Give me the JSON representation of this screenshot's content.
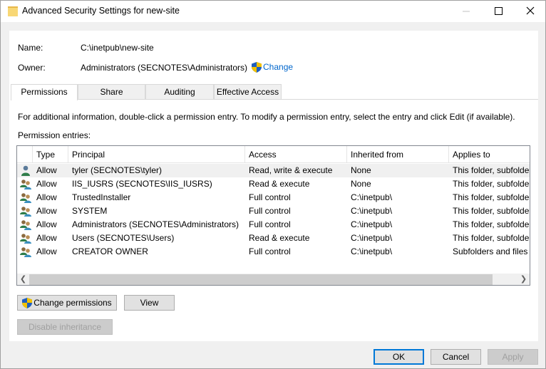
{
  "window": {
    "title": "Advanced Security Settings for new-site"
  },
  "info": {
    "name_label": "Name:",
    "name_value": "C:\\inetpub\\new-site",
    "owner_label": "Owner:",
    "owner_value": "Administrators (SECNOTES\\Administrators)",
    "change_link": "Change"
  },
  "tabs": [
    {
      "label": "Permissions",
      "active": true
    },
    {
      "label": "Share",
      "active": false
    },
    {
      "label": "Auditing",
      "active": false
    },
    {
      "label": "Effective Access",
      "active": false
    }
  ],
  "instructions": "For additional information, double-click a permission entry. To modify a permission entry, select the entry and click Edit (if available).",
  "entries_label": "Permission entries:",
  "columns": [
    "Type",
    "Principal",
    "Access",
    "Inherited from",
    "Applies to"
  ],
  "entries": [
    {
      "icon": "user-icon",
      "type": "Allow",
      "principal": "tyler (SECNOTES\\tyler)",
      "access": "Read, write & execute",
      "inherited": "None",
      "applies": "This folder, subfolders"
    },
    {
      "icon": "group-icon",
      "type": "Allow",
      "principal": "IIS_IUSRS (SECNOTES\\IIS_IUSRS)",
      "access": "Read & execute",
      "inherited": "None",
      "applies": "This folder, subfolders"
    },
    {
      "icon": "group-icon",
      "type": "Allow",
      "principal": "TrustedInstaller",
      "access": "Full control",
      "inherited": "C:\\inetpub\\",
      "applies": "This folder, subfolders"
    },
    {
      "icon": "group-icon",
      "type": "Allow",
      "principal": "SYSTEM",
      "access": "Full control",
      "inherited": "C:\\inetpub\\",
      "applies": "This folder, subfolders"
    },
    {
      "icon": "group-icon",
      "type": "Allow",
      "principal": "Administrators (SECNOTES\\Administrators)",
      "access": "Full control",
      "inherited": "C:\\inetpub\\",
      "applies": "This folder, subfolders"
    },
    {
      "icon": "group-icon",
      "type": "Allow",
      "principal": "Users (SECNOTES\\Users)",
      "access": "Read & execute",
      "inherited": "C:\\inetpub\\",
      "applies": "This folder, subfolders"
    },
    {
      "icon": "group-icon",
      "type": "Allow",
      "principal": "CREATOR OWNER",
      "access": "Full control",
      "inherited": "C:\\inetpub\\",
      "applies": "Subfolders and files only"
    }
  ],
  "buttons": {
    "change_permissions": "Change permissions",
    "view": "View",
    "disable_inheritance": "Disable inheritance",
    "ok": "OK",
    "cancel": "Cancel",
    "apply": "Apply"
  },
  "colors": {
    "link": "#0066cc",
    "default_button_border": "#0078d7",
    "selected_row": "#f0f0f0"
  }
}
